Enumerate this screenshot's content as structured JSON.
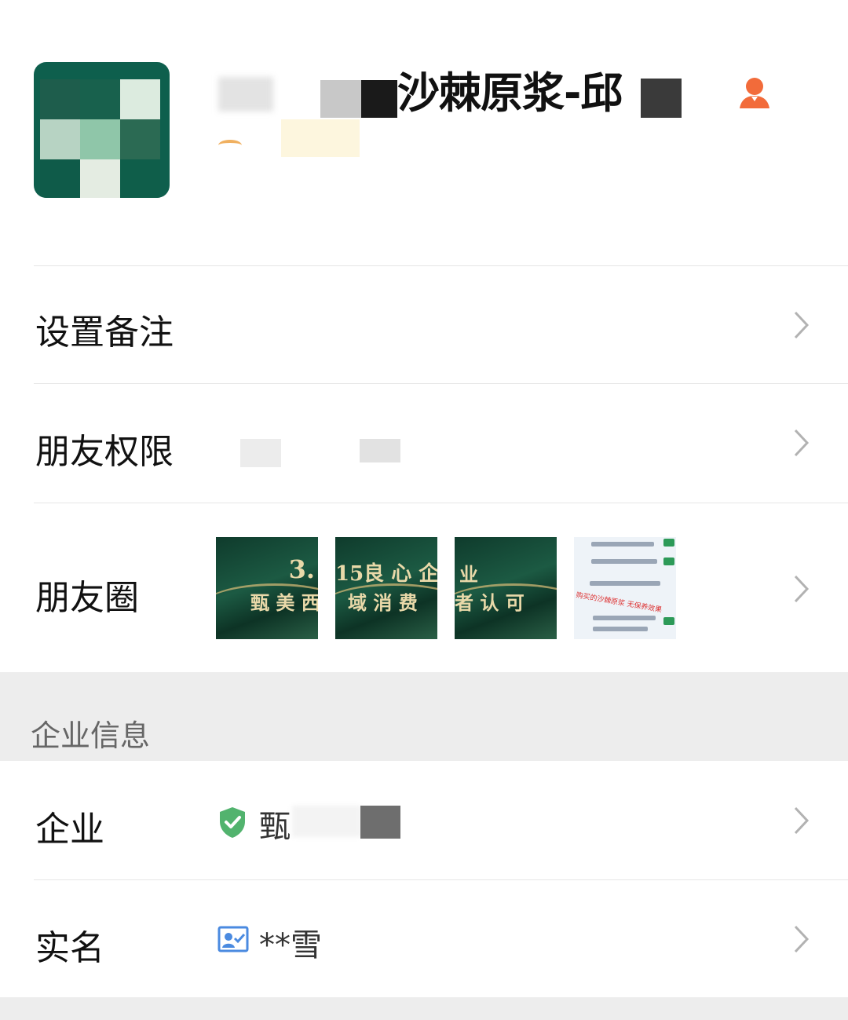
{
  "profile": {
    "name_visible": "沙棘原浆-邱",
    "gender_icon": "female-user-icon",
    "avatar_icon": "company-logo-avatar"
  },
  "rows": {
    "remark": {
      "label": "设置备注"
    },
    "permission": {
      "label": "朋友权限"
    },
    "moments": {
      "label": "朋友圈",
      "thumb1": {
        "caption_line1": "3.",
        "caption_line2": "甄 美 西"
      },
      "thumb2": {
        "caption_line1": "15良 心 企",
        "caption_line2": "域 消 费"
      },
      "thumb3": {
        "caption_line1": "业",
        "caption_line2": "者 认 可"
      },
      "thumb4": {
        "caption": "购买的沙棘原浆  无保养效果"
      }
    }
  },
  "section": {
    "title": "企业信息"
  },
  "company": {
    "label": "企业",
    "value_visible": "甄",
    "verified_icon": "verified-shield-icon"
  },
  "realname": {
    "label": "实名",
    "value": "**雪",
    "id_card_icon": "id-card-icon"
  },
  "colors": {
    "verified_green": "#52b36e",
    "gender_orange": "#f26b3a",
    "id_blue": "#4a8ae0",
    "section_bg": "#ededed"
  }
}
